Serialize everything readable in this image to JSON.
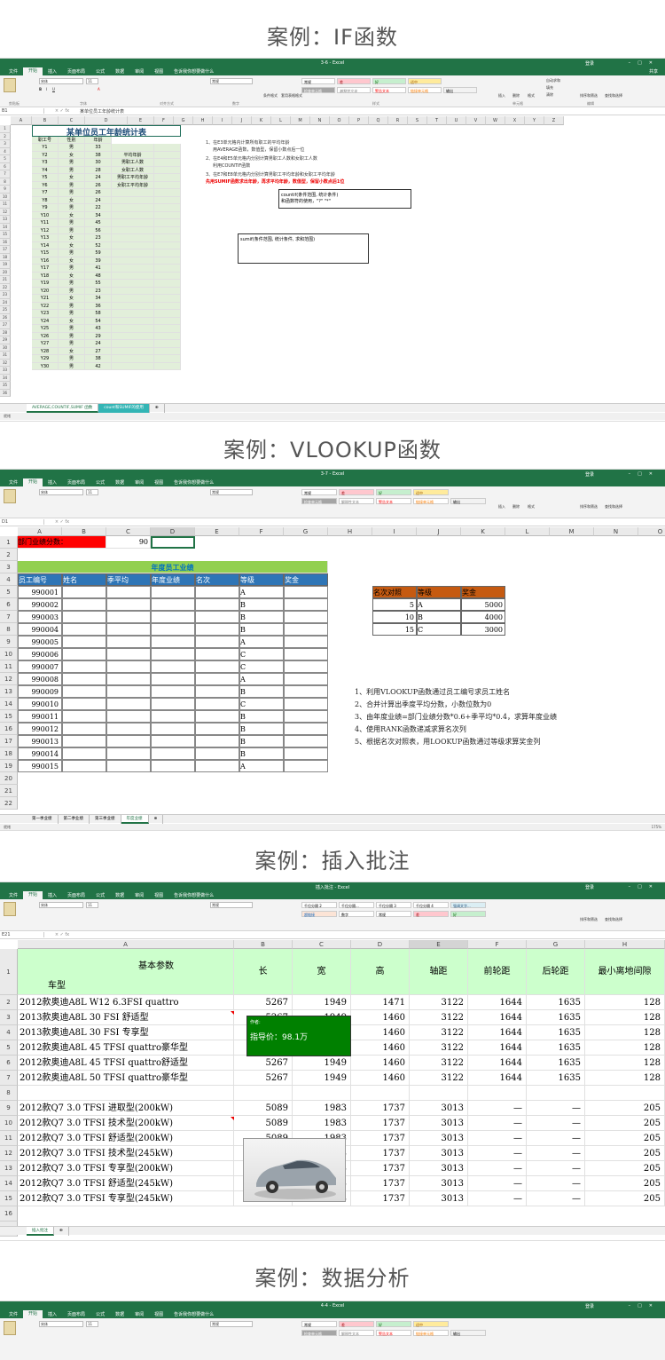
{
  "case_titles": [
    "案例：IF函数",
    "案例：VLOOKUP函数",
    "案例：插入批注",
    "案例：数据分析"
  ],
  "excel": {
    "tabs": [
      "文件",
      "开始",
      "插入",
      "页面布局",
      "公式",
      "数据",
      "审阅",
      "视图",
      "告诉我你想要做什么"
    ],
    "share": "共享",
    "user": "登录",
    "font_name": "宋体",
    "font_size": "11",
    "number_format": "常规",
    "groups": [
      "剪贴板",
      "字体",
      "对齐方式",
      "数字",
      "样式",
      "单元格",
      "编辑"
    ],
    "cond_format": "条件格式",
    "table_format": "套用表格格式",
    "styles_row1": [
      "常规",
      "差",
      "好",
      "适中"
    ],
    "styles_row2": [
      "检查单元格",
      "解释性文本",
      "警告文本",
      "链接单元格",
      "输出"
    ],
    "insert": "插入",
    "delete": "删除",
    "format": "格式",
    "autosum": "自动求和",
    "fill": "填充",
    "clear": "清除",
    "sort_filter": "排序和筛选",
    "find_select": "查找和选择"
  },
  "shot1": {
    "filename": "3-6 - Excel",
    "namebox": "B1",
    "formula": "某单位员工年龄统计表",
    "table_title": "某单位员工年龄统计表",
    "headers": [
      "职工号",
      "性别",
      "年龄"
    ],
    "rows": [
      [
        "Y1",
        "男",
        "33"
      ],
      [
        "Y2",
        "女",
        "38"
      ],
      [
        "Y3",
        "男",
        "30"
      ],
      [
        "Y4",
        "男",
        "28"
      ],
      [
        "Y5",
        "女",
        "24"
      ],
      [
        "Y6",
        "男",
        "26"
      ],
      [
        "Y7",
        "男",
        "26"
      ],
      [
        "Y8",
        "女",
        "24"
      ],
      [
        "Y9",
        "男",
        "22"
      ],
      [
        "Y10",
        "女",
        "34"
      ],
      [
        "Y11",
        "男",
        "45"
      ],
      [
        "Y12",
        "男",
        "56"
      ],
      [
        "Y13",
        "女",
        "23"
      ],
      [
        "Y14",
        "女",
        "52"
      ],
      [
        "Y15",
        "男",
        "59"
      ],
      [
        "Y16",
        "女",
        "39"
      ],
      [
        "Y17",
        "男",
        "41"
      ],
      [
        "Y18",
        "女",
        "48"
      ],
      [
        "Y19",
        "男",
        "55"
      ],
      [
        "Y20",
        "男",
        "23"
      ],
      [
        "Y21",
        "女",
        "34"
      ],
      [
        "Y22",
        "男",
        "36"
      ],
      [
        "Y23",
        "男",
        "58"
      ],
      [
        "Y24",
        "女",
        "54"
      ],
      [
        "Y25",
        "男",
        "43"
      ],
      [
        "Y26",
        "男",
        "29"
      ],
      [
        "Y27",
        "男",
        "24"
      ],
      [
        "Y28",
        "女",
        "27"
      ],
      [
        "Y29",
        "男",
        "38"
      ],
      [
        "Y30",
        "男",
        "42"
      ]
    ],
    "side_labels": [
      "平均年龄",
      "男职工人数",
      "女职工人数",
      "男职工平均年龄",
      "女职工平均年龄"
    ],
    "notes": [
      "1、在E3单元格内计算所有职工的平均年龄",
      "用AVERAGE函数，数值型，保留小数点后一位",
      "2、在E4和E5单元格内分别计算男职工人数和女职工人数",
      "利用COUNTIF函数",
      "3、在E7和E8单元格内分别计算男职工平均年龄和女职工平均年龄",
      "先用SUMIF函数求出年龄，再求平均年龄，数值型，保留小数点后1位"
    ],
    "bubble1": "countif(条件范围, 统计条件)\n和函数符的使用，\"?\" \"*\"",
    "bubble2": "sumif(条件范围, 统计条件, 求和范围)",
    "sheet_tabs": [
      "AVERAGE,COUNTIF,SUMIF 函数",
      "count和SUMIF的使用"
    ],
    "status": "就绪"
  },
  "shot2": {
    "filename": "3-7 - Excel",
    "namebox": "D1",
    "cols": [
      "A",
      "B",
      "C",
      "D",
      "E",
      "F",
      "G",
      "H",
      "I",
      "J",
      "K",
      "L",
      "M",
      "N",
      "O"
    ],
    "dept_label": "部门业绩分数：",
    "dept_value": "90",
    "table_title": "年度员工业绩",
    "headers": [
      "员工编号",
      "姓名",
      "季平均",
      "年度业绩",
      "名次",
      "等级",
      "奖金"
    ],
    "ids": [
      "990001",
      "990002",
      "990003",
      "990004",
      "990005",
      "990006",
      "990007",
      "990008",
      "990009",
      "990010",
      "990011",
      "990012",
      "990013",
      "990014",
      "990015"
    ],
    "grades": [
      "A",
      "B",
      "B",
      "B",
      "A",
      "C",
      "C",
      "A",
      "B",
      "C",
      "B",
      "B",
      "B",
      "B",
      "A"
    ],
    "lookup_headers": [
      "名次对照",
      "等级",
      "奖金"
    ],
    "lookup_rows": [
      [
        "5",
        "A",
        "5000"
      ],
      [
        "10",
        "B",
        "4000"
      ],
      [
        "15",
        "C",
        "3000"
      ]
    ],
    "notes": [
      "1、利用VLOOKUP函数通过员工编号求员工姓名",
      "2、合并计算出季度平均分数，小数位数为0",
      "3、由年度业绩=部门业绩分数*0.6+季平均*0.4，求算年度业绩",
      "4、使用RANK函数递减求算名次列",
      "5、根据名次对照表，用LOOKUP函数通过等级求算奖金列"
    ],
    "sheet_tabs": [
      "第一季业绩",
      "第二季业绩",
      "第三季业绩",
      "年度业绩"
    ],
    "status": "就绪",
    "zoom": "175%"
  },
  "shot3": {
    "filename": "插入批注 - Excel",
    "namebox": "E21",
    "cols": [
      "A",
      "B",
      "C",
      "D",
      "E",
      "F",
      "G",
      "H"
    ],
    "header_a_top": "基本参数",
    "header_a_bottom": "车型",
    "headers": [
      "长",
      "宽",
      "高",
      "轴距",
      "前轮距",
      "后轮距",
      "最小离地间隙"
    ],
    "rows": [
      [
        "2012款奥迪A8L W12 6.3FSI quattro",
        "5267",
        "1949",
        "1471",
        "3122",
        "1644",
        "1635",
        "128"
      ],
      [
        "2013款奥迪A8L 30 FSI  舒适型",
        "5267",
        "1949",
        "1460",
        "3122",
        "1644",
        "1635",
        "128"
      ],
      [
        "2013款奥迪A8L 30 FSI  专享型",
        "5267",
        "1949",
        "1460",
        "3122",
        "1644",
        "1635",
        "128"
      ],
      [
        "2012款奥迪A8L 45 TFSI quattro豪华型",
        "5267",
        "1949",
        "1460",
        "3122",
        "1644",
        "1635",
        "128"
      ],
      [
        "2012款奥迪A8L 45 TFSI quattro舒适型",
        "5267",
        "1949",
        "1460",
        "3122",
        "1644",
        "1635",
        "128"
      ],
      [
        "2012款奥迪A8L 50 TFSI quattro豪华型",
        "5267",
        "1949",
        "1460",
        "3122",
        "1644",
        "1635",
        "128"
      ],
      [
        "",
        "",
        "",
        "",
        "",
        "",
        "",
        ""
      ],
      [
        "2012款Q7 3.0 TFSI 进取型(200kW)",
        "5089",
        "1983",
        "1737",
        "3013",
        "—",
        "—",
        "205"
      ],
      [
        "2012款Q7 3.0 TFSI 技术型(200kW)",
        "5089",
        "1983",
        "1737",
        "3013",
        "—",
        "—",
        "205"
      ],
      [
        "2012款Q7 3.0 TFSI 舒适型(200kW)",
        "5089",
        "1983",
        "1737",
        "3013",
        "—",
        "—",
        "205"
      ],
      [
        "2012款Q7 3.0 TFSI 技术型(245kW)",
        "5089",
        "1983",
        "1737",
        "3013",
        "—",
        "—",
        "205"
      ],
      [
        "2012款Q7 3.0 TFSI 专享型(200kW)",
        "5089",
        "1983",
        "1737",
        "3013",
        "—",
        "—",
        "205"
      ],
      [
        "2012款Q7 3.0 TFSI 舒适型(245kW)",
        "5089",
        "1983",
        "1737",
        "3013",
        "—",
        "—",
        "205"
      ],
      [
        "2012款Q7 3.0 TFSI 专享型(245kW)",
        "5089",
        "1983",
        "1737",
        "3013",
        "—",
        "—",
        "205"
      ]
    ],
    "comment_author": "作者:",
    "comment_text": "指导价：98.1万",
    "styles": [
      "千位分隔 2",
      "千位分隔...",
      "千位分隔 3",
      "千位分隔 4",
      "强调文字...",
      "超链接",
      "数字",
      "常规",
      "差",
      "好"
    ],
    "sheet_tabs": [
      "插入批注"
    ]
  },
  "shot4": {
    "filename": "4-4 - Excel"
  }
}
